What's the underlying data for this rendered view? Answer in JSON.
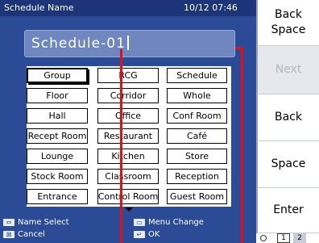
{
  "header": {
    "title": "Schedule Name",
    "datetime": "10/12 07:46"
  },
  "name_input": {
    "value": "Schedule-01"
  },
  "name_buttons": [
    "Group",
    "RCG",
    "Schedule",
    "Floor",
    "Corridor",
    "Whole",
    "Hall",
    "Office",
    "Conf Room",
    "Recept Room",
    "Restaurant",
    "Café",
    "Lounge",
    "Kitchen",
    "Store",
    "Stock Room",
    "Classroom",
    "Reception",
    "Entrance",
    "Control Room",
    "Guest Room"
  ],
  "help": {
    "name_select": "Name Select",
    "cancel": "Cancel",
    "menu_change": "Menu Change",
    "ok": "OK"
  },
  "side_buttons": {
    "backspace": "Back\nSpace",
    "next": "Next",
    "back": "Back",
    "space": "Space",
    "enter": "Enter"
  },
  "pager": {
    "page1": "1",
    "page2": "2"
  },
  "colors": {
    "panel": "#2b4b96",
    "title_bar": "#1c3578",
    "annotation": "#e0101a"
  }
}
